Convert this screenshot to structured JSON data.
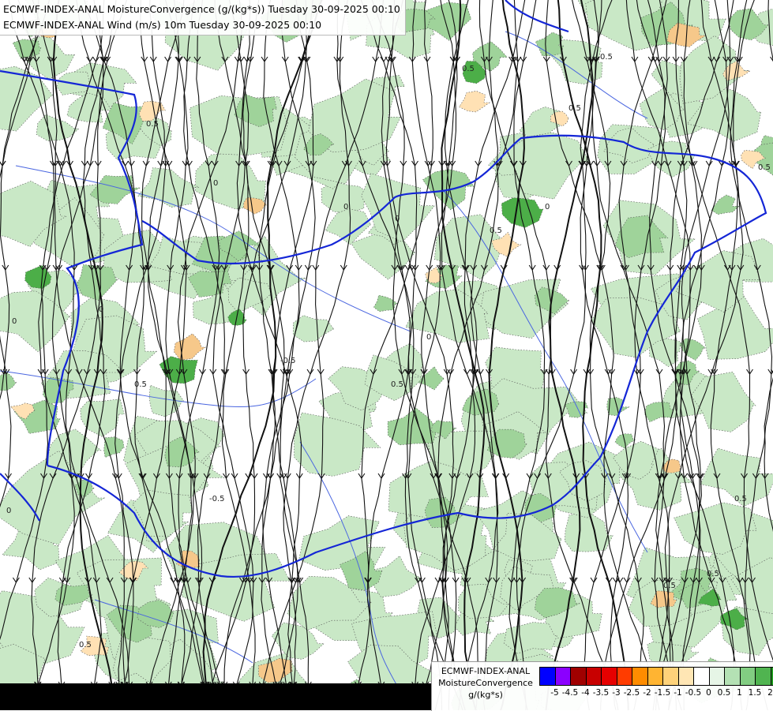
{
  "header": {
    "line1": "ECMWF-INDEX-ANAL MoistureConvergence (g/(kg*s)) Tuesday 30-09-2025 00:10",
    "line2": "ECMWF-INDEX-ANAL Wind (m/s) 10m Tuesday 30-09-2025 00:10"
  },
  "legend": {
    "title_lines": [
      "ECMWF-INDEX-ANAL",
      "MoistureConvergence",
      "g/(kg*s)"
    ],
    "swatch_colors": [
      "#0000ff",
      "#8b00ff",
      "#a00000",
      "#c80000",
      "#e60000",
      "#ff3c00",
      "#ff8c00",
      "#ffb432",
      "#ffd27a",
      "#ffe6b4",
      "#ffffff",
      "#e6f5e6",
      "#b4e1b4",
      "#82cd82",
      "#50b450",
      "#1e9b1e"
    ],
    "tick_labels": [
      "-5",
      "-4.5",
      "-4",
      "-3.5",
      "-3",
      "-2.5",
      "-2",
      "-1.5",
      "-1",
      "-0.5",
      "0",
      "0.5",
      "1",
      "1.5",
      "2"
    ]
  },
  "map": {
    "contour_labels": [
      "0.5",
      "0",
      "0.5",
      "0",
      "0.5",
      "0",
      "-0.5",
      "0.5",
      "0",
      "0.5",
      "0",
      "0.5",
      "0.5",
      "0",
      "0.5",
      "-0.5",
      "0.5",
      "0",
      "0.5",
      "0.5",
      "0.5",
      "0"
    ],
    "colors": {
      "background": "#ffffff",
      "green_light": "#c9e8c6",
      "green_mid": "#9fd39a",
      "green_dark": "#4cae48",
      "orange_light": "#ffe1b4",
      "orange_mid": "#f6c88a",
      "border": "#1426d6",
      "river": "#4a66e0",
      "streamline": "#111111"
    }
  }
}
